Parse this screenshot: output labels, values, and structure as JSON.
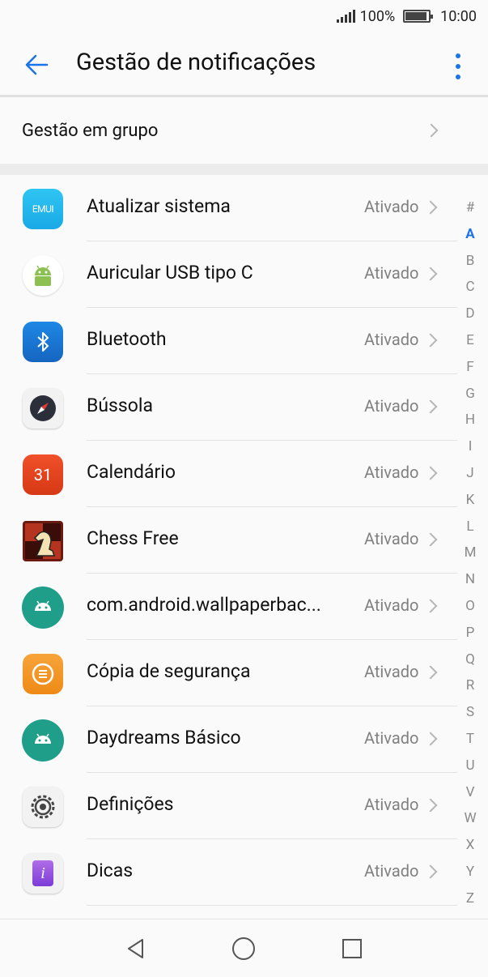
{
  "status_bar": {
    "battery": "100%",
    "time": "10:00"
  },
  "header": {
    "title": "Gestão de notificações"
  },
  "group": {
    "label": "Gestão em grupo"
  },
  "apps": [
    {
      "name": "Atualizar sistema",
      "status": "Ativado",
      "icon": "emui-update-icon"
    },
    {
      "name": "Auricular USB tipo C",
      "status": "Ativado",
      "icon": "android-icon"
    },
    {
      "name": "Bluetooth",
      "status": "Ativado",
      "icon": "bluetooth-icon"
    },
    {
      "name": "Bússola",
      "status": "Ativado",
      "icon": "compass-icon"
    },
    {
      "name": "Calendário",
      "status": "Ativado",
      "icon": "calendar-icon",
      "icon_text": "31"
    },
    {
      "name": "Chess Free",
      "status": "Ativado",
      "icon": "chess-icon"
    },
    {
      "name": "com.android.wallpaperbac...",
      "status": "Ativado",
      "icon": "android-wallpaper-icon"
    },
    {
      "name": "Cópia de segurança",
      "status": "Ativado",
      "icon": "backup-icon"
    },
    {
      "name": "Daydreams Básico",
      "status": "Ativado",
      "icon": "daydreams-icon"
    },
    {
      "name": "Definições",
      "status": "Ativado",
      "icon": "settings-icon"
    },
    {
      "name": "Dicas",
      "status": "Ativado",
      "icon": "tips-icon",
      "icon_text": "i"
    }
  ],
  "alphabet": [
    "#",
    "A",
    "B",
    "C",
    "D",
    "E",
    "F",
    "G",
    "H",
    "I",
    "J",
    "K",
    "L",
    "M",
    "N",
    "O",
    "P",
    "Q",
    "R",
    "S",
    "T",
    "U",
    "V",
    "W",
    "X",
    "Y",
    "Z"
  ],
  "alphabet_active": "A",
  "icon_labels": {
    "emui": "EMUI"
  },
  "colors": {
    "accent": "#1a73e8"
  }
}
